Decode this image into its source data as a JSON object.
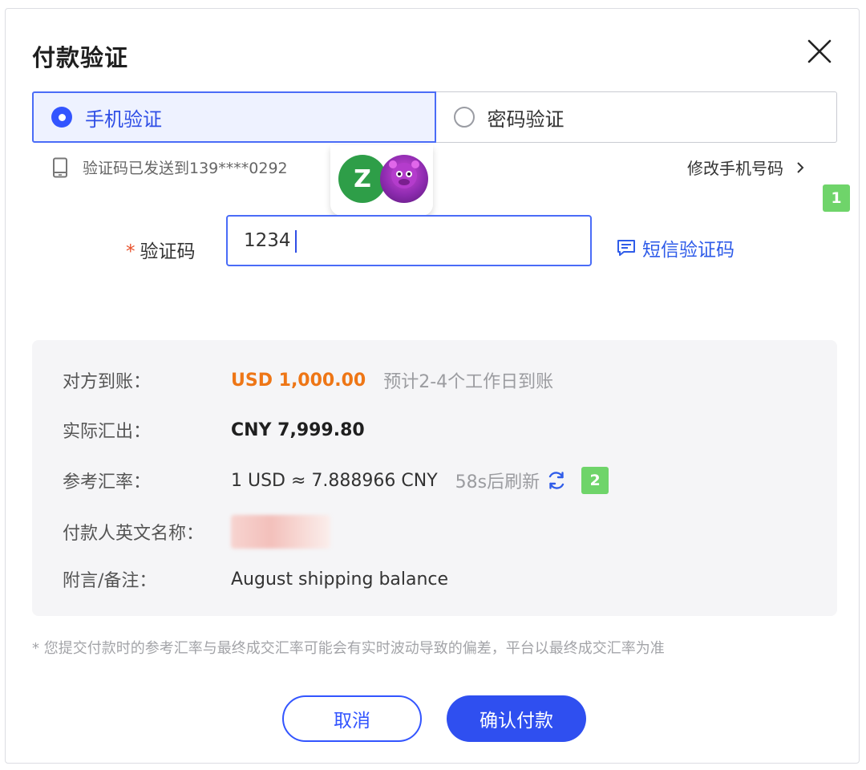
{
  "dialog": {
    "title": "付款验证"
  },
  "tabs": [
    {
      "label": "手机验证",
      "selected": true
    },
    {
      "label": "密码验证",
      "selected": false
    }
  ],
  "sent_notice": "验证码已发送到139****0292",
  "change_phone_label": "修改手机号码",
  "avatars": {
    "initial": "Z"
  },
  "badges": {
    "first": "1",
    "second": "2"
  },
  "code_field": {
    "required_mark": "*",
    "label": "验证码",
    "value": "1234"
  },
  "sms_button_label": "短信验证码",
  "details": {
    "received": {
      "label": "对方到账：",
      "amount": "USD 1,000.00",
      "eta": "预计2-4个工作日到账"
    },
    "sent": {
      "label": "实际汇出：",
      "amount": "CNY 7,999.80"
    },
    "rate": {
      "label": "参考汇率：",
      "value": "1 USD ≈ 7.888966 CNY",
      "refresh": "58s后刷新"
    },
    "payer": {
      "label": "付款人英文名称："
    },
    "memo": {
      "label": "附言/备注：",
      "value": "August shipping balance"
    }
  },
  "footnote": "* 您提交付款时的参考汇率与最终成交汇率可能会有实时波动导致的偏差，平台以最终成交汇率为准",
  "buttons": {
    "cancel": "取消",
    "confirm": "确认付款"
  },
  "colors": {
    "primary": "#3355ff",
    "amount_orange": "#ee7616",
    "badge_green": "#6fd46a",
    "panel_bg": "#f5f5f7"
  }
}
